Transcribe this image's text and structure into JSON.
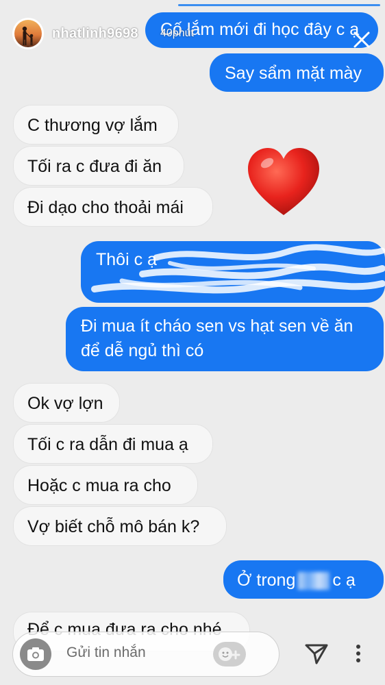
{
  "story": {
    "username": "nhatlinh9698",
    "time_ago": "40phút"
  },
  "messages": [
    {
      "side": "out",
      "text": "Cố lắm mới đi học đây c ạ"
    },
    {
      "side": "out",
      "text": "Say sẩm mặt mày"
    },
    {
      "side": "in",
      "text": "C thương vợ lắm"
    },
    {
      "side": "in",
      "text": "Tối ra c đưa đi ăn"
    },
    {
      "side": "in",
      "text": "Đi dạo cho thoải mái"
    },
    {
      "side": "out",
      "text": "Thôi c ạ"
    },
    {
      "side": "out",
      "text": "Đi mua ít cháo sen vs hạt sen về ăn"
    },
    {
      "side": "out",
      "text": "để dễ ngủ thì có"
    },
    {
      "side": "in",
      "text": "Ok vợ lợn"
    },
    {
      "side": "in",
      "text": "Tối c ra dẫn đi mua ạ"
    },
    {
      "side": "in",
      "text": "Hoặc c mua ra cho"
    },
    {
      "side": "in",
      "text": "Vợ biết chỗ mô bán k?"
    },
    {
      "side": "out",
      "text": "Ở trong"
    },
    {
      "side": "out",
      "text": "c ạ"
    },
    {
      "side": "in",
      "text": "Để c mua đưa ra cho nhé"
    }
  ],
  "composer": {
    "placeholder": "Gửi tin nhắn"
  },
  "colors": {
    "outgoing_bubble": "#1877f2",
    "incoming_bubble": "#f6f6f6",
    "background": "#ececec"
  },
  "icons": [
    "close-icon",
    "heart-sticker",
    "camera-icon",
    "sticker-icon",
    "send-icon",
    "more-icon"
  ]
}
